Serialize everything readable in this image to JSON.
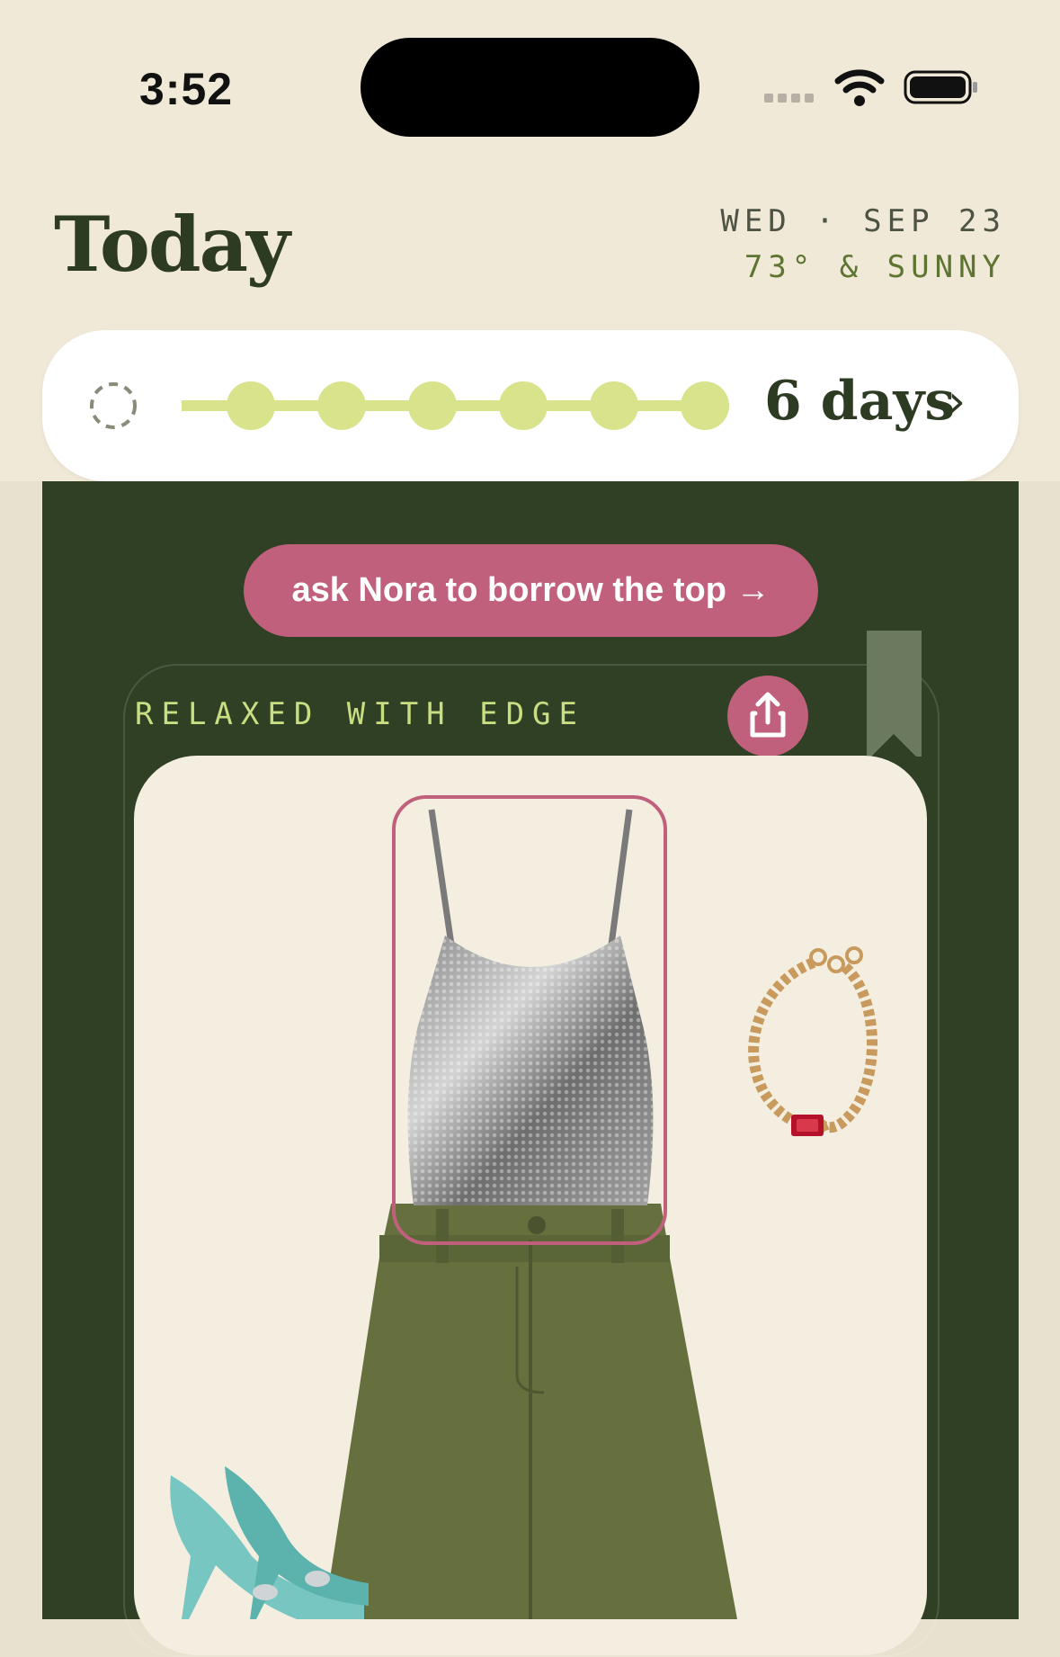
{
  "status_bar": {
    "time": "3:52"
  },
  "header": {
    "title": "Today",
    "date": "WED · SEP 23",
    "weather": "73° & SUNNY"
  },
  "streak": {
    "count_label": "6 days",
    "filled_days": 6,
    "chevron": "›"
  },
  "borrow_button": {
    "label": "ask Nora to borrow the top →"
  },
  "look": {
    "label": "RELAXED WITH EDGE",
    "items": [
      "sequin-top",
      "necklace",
      "skirt",
      "heels"
    ]
  },
  "colors": {
    "accent_pink": "#c1607d",
    "forest": "#2f4024",
    "lime": "#d9e38b",
    "cream": "#f4eee0"
  }
}
